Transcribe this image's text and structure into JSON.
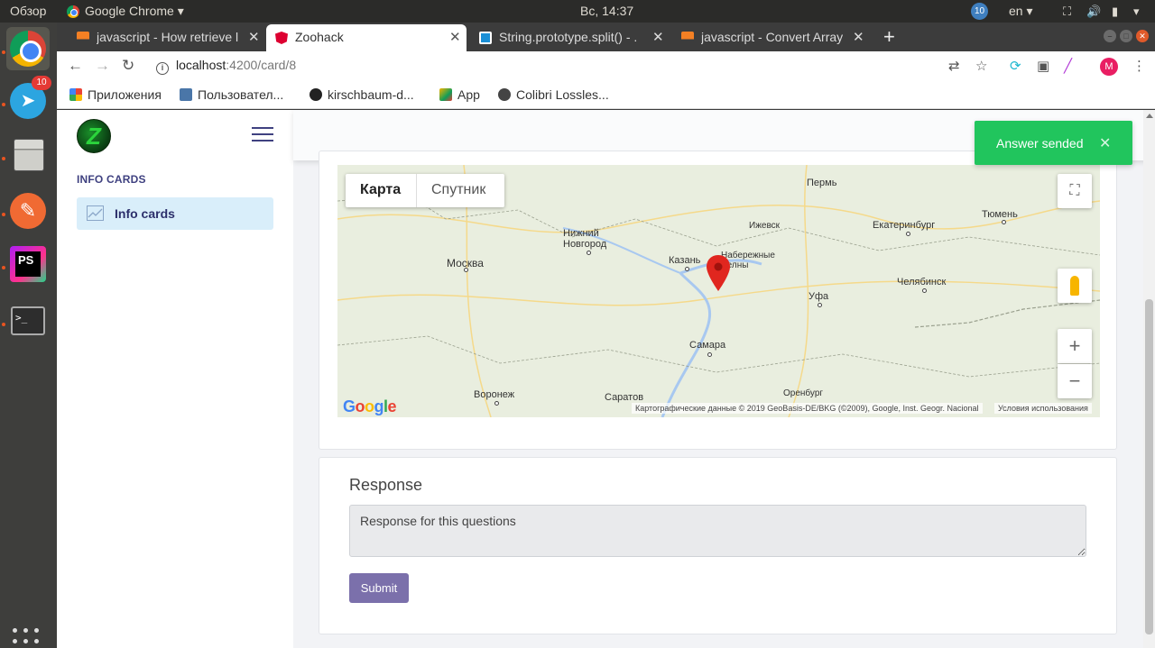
{
  "system_bar": {
    "activities": "Обзор",
    "app_name": "Google Chrome",
    "clock": "Вс, 14:37",
    "notification_count": "10",
    "language": "en"
  },
  "dock": {
    "telegram_badge": "10",
    "terminal_glyph": ">_",
    "phpstorm_label": "PS"
  },
  "browser": {
    "tabs": [
      {
        "label": "javascript - How retrieve l",
        "active": false
      },
      {
        "label": "Zoohack",
        "active": true
      },
      {
        "label": "String.prototype.split() - .",
        "active": false
      },
      {
        "label": "javascript - Convert Array",
        "active": false
      }
    ],
    "url_host": "localhost",
    "url_path": ":4200/card/8",
    "avatar_letter": "M",
    "bookmarks": [
      {
        "label": "Приложения",
        "icon": "apps-grid-icon"
      },
      {
        "label": "Пользовател...",
        "icon": "vk-icon"
      },
      {
        "label": "kirschbaum-d...",
        "icon": "github-icon"
      },
      {
        "label": "App",
        "icon": "cube-icon"
      },
      {
        "label": "Colibri Lossles...",
        "icon": "globe-icon"
      }
    ]
  },
  "app": {
    "sidebar": {
      "logo_letter": "Z",
      "section_heading": "INFO CARDS",
      "items": [
        {
          "label": "Info cards",
          "icon": "chart-line-icon"
        }
      ]
    },
    "map": {
      "type_map": "Карта",
      "type_satellite": "Спутник",
      "cities": [
        "Пермь",
        "Ижевск",
        "Екатеринбург",
        "Тюмень",
        "Нижний Новгород",
        "Москва",
        "Казань",
        "Набережные Челны",
        "Уфа",
        "Челябинск",
        "Самара",
        "Воронеж",
        "Саратов",
        "Оренбург"
      ],
      "logo": "Google",
      "attribution": "Картографические данные © 2019 GeoBasis-DE/BKG (©2009), Google, Inst. Geogr. Nacional",
      "terms": "Условия использования",
      "marker_color": "#e0261f"
    },
    "response": {
      "title": "Response",
      "value": "Response for this questions",
      "submit_label": "Submit"
    },
    "toast": {
      "message": "Answer sended",
      "close_glyph": "✕",
      "color": "#21c55d"
    }
  }
}
